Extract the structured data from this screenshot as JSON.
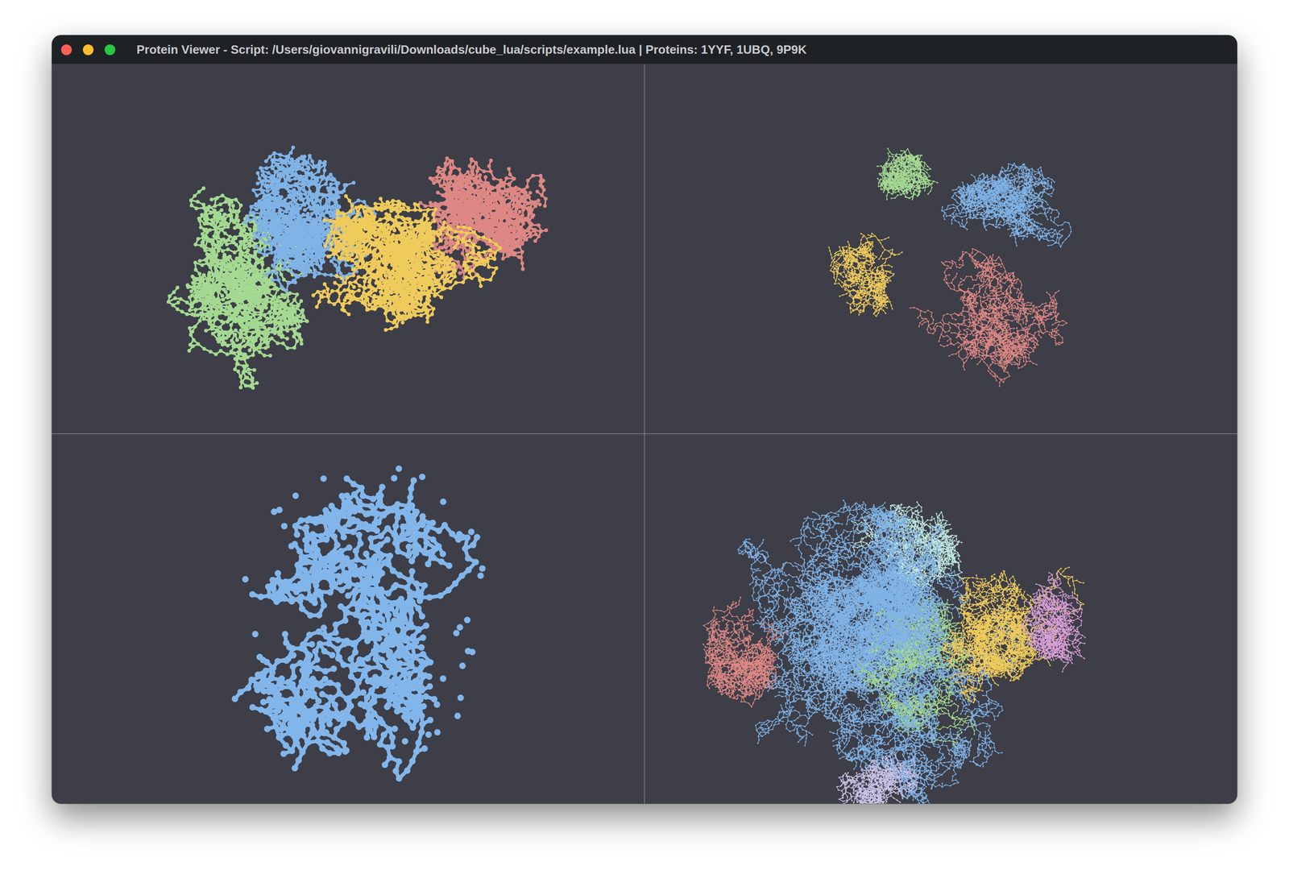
{
  "window": {
    "title": "Protein Viewer - Script: /Users/giovannigravili/Downloads/cube_lua/scripts/example.lua | Proteins: 1YYF, 1UBQ, 9P9K"
  },
  "viewports": [
    {
      "kind": "ball-stick",
      "chains": [
        {
          "color": "#a4d992"
        },
        {
          "color": "#80b3e6"
        },
        {
          "color": "#dd8884"
        },
        {
          "color": "#efcb5c"
        }
      ]
    },
    {
      "kind": "wire",
      "chains": [
        {
          "color": "#a4d992"
        },
        {
          "color": "#efcb5c"
        },
        {
          "color": "#80b3e6"
        },
        {
          "color": "#dd8884"
        }
      ]
    },
    {
      "kind": "spheres",
      "chains": [
        {
          "color": "#82b6ea"
        }
      ]
    },
    {
      "kind": "wire",
      "chains": [
        {
          "color": "#80b3e6"
        },
        {
          "color": "#dd8884"
        },
        {
          "color": "#a4d992"
        },
        {
          "color": "#efcb5c"
        },
        {
          "color": "#bfe6df"
        },
        {
          "color": "#d99fd6"
        },
        {
          "color": "#c9c3e6"
        },
        {
          "color": "#80b3e6"
        }
      ]
    }
  ]
}
